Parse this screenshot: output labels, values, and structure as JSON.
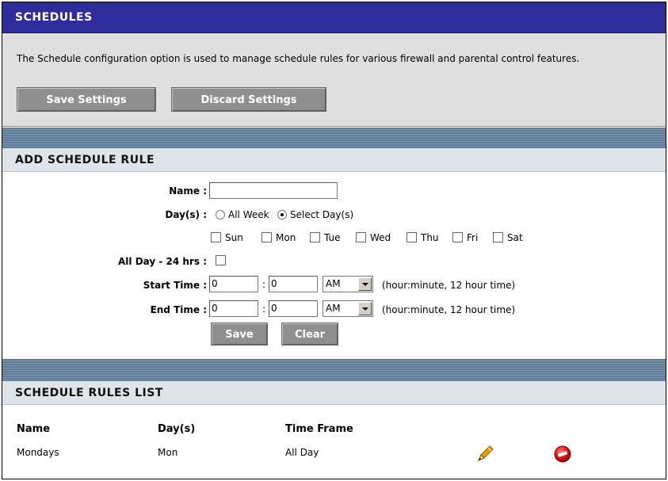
{
  "schedules": {
    "title": "SCHEDULES",
    "description": "The Schedule configuration option is used to manage schedule rules for various firewall and parental control features.",
    "save_settings_label": "Save Settings",
    "discard_settings_label": "Discard Settings"
  },
  "add_rule": {
    "title": "ADD SCHEDULE RULE",
    "name_label": "Name :",
    "name_value": "",
    "days_label": "Day(s) :",
    "all_week_label": "All Week",
    "select_days_label": "Select Day(s)",
    "selected_mode": "Select Day(s)",
    "days": [
      {
        "label": "Sun",
        "checked": false
      },
      {
        "label": "Mon",
        "checked": false
      },
      {
        "label": "Tue",
        "checked": false
      },
      {
        "label": "Wed",
        "checked": false
      },
      {
        "label": "Thu",
        "checked": false
      },
      {
        "label": "Fri",
        "checked": false
      },
      {
        "label": "Sat",
        "checked": false
      }
    ],
    "all_day_label": "All Day - 24 hrs :",
    "all_day_checked": false,
    "start_time_label": "Start Time :",
    "start_hour": "0",
    "start_minute": "0",
    "start_ampm": "AM",
    "end_time_label": "End Time :",
    "end_hour": "0",
    "end_minute": "0",
    "end_ampm": "AM",
    "colon": ":",
    "time_hint": "(hour:minute, 12 hour time)",
    "save_label": "Save",
    "clear_label": "Clear"
  },
  "rules_list": {
    "title": "SCHEDULE RULES LIST",
    "columns": [
      "Name",
      "Day(s)",
      "Time Frame"
    ],
    "rows": [
      {
        "name": "Mondays",
        "days": "Mon",
        "time_frame": "All Day",
        "edit_icon": "pencil-icon",
        "delete_icon": "delete-icon"
      }
    ]
  },
  "colors": {
    "title_bar": "#2f2c9c",
    "panel_bg": "#dfdfdf",
    "button_gray": "#8f8f8f",
    "band": "#6a87a3",
    "section_head": "#dfe4e8"
  }
}
